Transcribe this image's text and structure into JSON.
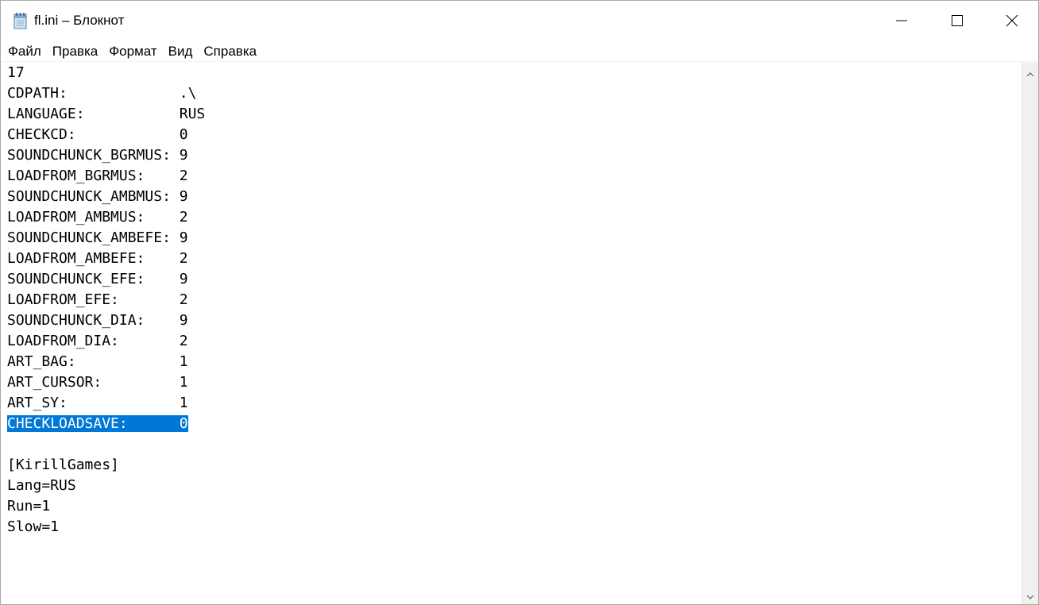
{
  "window": {
    "title": "fl.ini – Блокнот",
    "icon": "notepad-icon",
    "controls": {
      "minimize": "minimize-icon",
      "maximize": "maximize-icon",
      "close": "close-icon"
    }
  },
  "menubar": {
    "items": [
      "Файл",
      "Правка",
      "Формат",
      "Вид",
      "Справка"
    ]
  },
  "editor": {
    "lines": [
      "17",
      "CDPATH:             .\\",
      "LANGUAGE:           RUS",
      "CHECKCD:            0",
      "SOUNDCHUNCK_BGRMUS: 9",
      "LOADFROM_BGRMUS:    2",
      "SOUNDCHUNCK_AMBMUS: 9",
      "LOADFROM_AMBMUS:    2",
      "SOUNDCHUNCK_AMBEFE: 9",
      "LOADFROM_AMBEFE:    2",
      "SOUNDCHUNCK_EFE:    9",
      "LOADFROM_EFE:       2",
      "SOUNDCHUNCK_DIA:    9",
      "LOADFROM_DIA:       2",
      "ART_BAG:            1",
      "ART_CURSOR:         1",
      "ART_SY:             1",
      "CHECKLOADSAVE:      0",
      "",
      "[KirillGames]",
      "Lang=RUS",
      "Run=1",
      "Slow=1"
    ],
    "selected_line_index": 17,
    "selection_color": "#0078d7"
  },
  "scrollbar": {
    "up": "scroll-up-arrow-icon",
    "down": "scroll-down-arrow-icon"
  }
}
